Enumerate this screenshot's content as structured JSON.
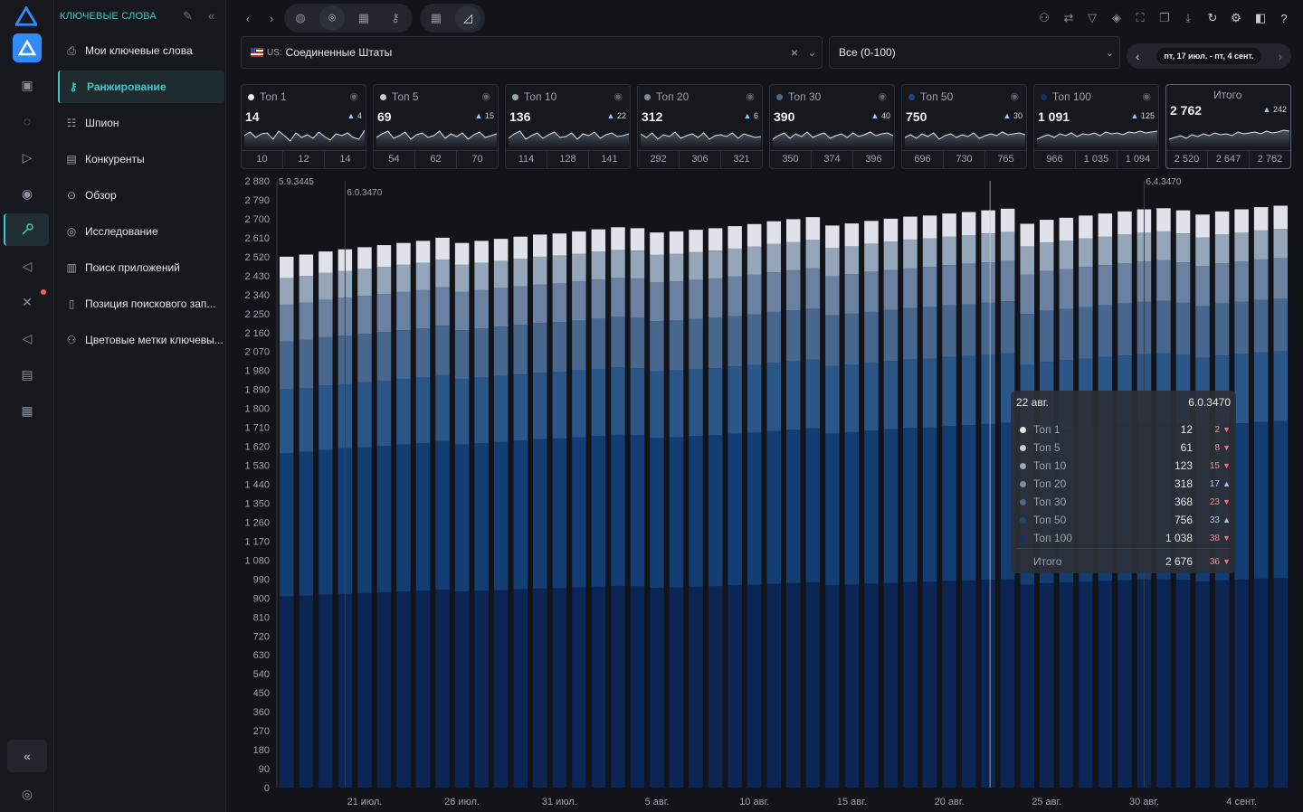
{
  "sidebar": {
    "title": "КЛЮЧЕВЫЕ СЛОВА",
    "items": [
      {
        "label": "Мои ключевые слова",
        "icon": "bookmark-icon"
      },
      {
        "label": "Ранжирование",
        "icon": "key-icon",
        "active": true
      },
      {
        "label": "Шпион",
        "icon": "stack-icon"
      },
      {
        "label": "Конкуренты",
        "icon": "book-icon"
      },
      {
        "label": "Обзор",
        "icon": "focus-icon"
      },
      {
        "label": "Исследование",
        "icon": "compass-icon"
      },
      {
        "label": "Поиск приложений",
        "icon": "bars-icon"
      },
      {
        "label": "Позиция поискового зап...",
        "icon": "document-icon"
      },
      {
        "label": "Цветовые метки ключевы...",
        "icon": "palette-icon"
      }
    ]
  },
  "filters": {
    "country_code": "US:",
    "country": "Соединенные Штаты",
    "range": "Все (0-100)",
    "date_range": "пт, 17 июл. - пт, 4 сент."
  },
  "cards": [
    {
      "label": "Топ 1",
      "value": "14",
      "change": "4",
      "color": "#e9ebef",
      "ticks": [
        "10",
        "12",
        "14"
      ]
    },
    {
      "label": "Топ 5",
      "value": "69",
      "change": "15",
      "color": "#c7cbd2",
      "ticks": [
        "54",
        "62",
        "70"
      ]
    },
    {
      "label": "Топ 10",
      "value": "136",
      "change": "22",
      "color": "#9aa6b8",
      "ticks": [
        "114",
        "128",
        "141"
      ]
    },
    {
      "label": "Топ 20",
      "value": "312",
      "change": "6",
      "color": "#7d8ba1",
      "ticks": [
        "292",
        "306",
        "321"
      ]
    },
    {
      "label": "Топ 30",
      "value": "390",
      "change": "40",
      "color": "#4f6888",
      "ticks": [
        "350",
        "374",
        "396"
      ]
    },
    {
      "label": "Топ 50",
      "value": "750",
      "change": "30",
      "color": "#1f4877",
      "ticks": [
        "696",
        "730",
        "765"
      ]
    },
    {
      "label": "Топ 100",
      "value": "1 091",
      "change": "125",
      "color": "#123363",
      "ticks": [
        "966",
        "1 035",
        "1 094"
      ]
    },
    {
      "label": "Итого",
      "value": "2 762",
      "change": "242",
      "color": "",
      "ticks": [
        "2 520",
        "2 647",
        "2 762"
      ]
    }
  ],
  "tooltip": {
    "date": "22 авг.",
    "version": "6.0.3470",
    "rows": [
      {
        "name": "Топ 1",
        "value": "12",
        "change": "2",
        "dir": "down",
        "color": "#e9ebef"
      },
      {
        "name": "Топ 5",
        "value": "61",
        "change": "8",
        "dir": "down",
        "color": "#c7cbd2"
      },
      {
        "name": "Топ 10",
        "value": "123",
        "change": "15",
        "dir": "down",
        "color": "#9aa6b8"
      },
      {
        "name": "Топ 20",
        "value": "318",
        "change": "17",
        "dir": "up",
        "color": "#7d8ba1"
      },
      {
        "name": "Топ 30",
        "value": "368",
        "change": "23",
        "dir": "down",
        "color": "#4f6888"
      },
      {
        "name": "Топ 50",
        "value": "756",
        "change": "33",
        "dir": "up",
        "color": "#1f4877"
      },
      {
        "name": "Топ 100",
        "value": "1 038",
        "change": "38",
        "dir": "down",
        "color": "#123363"
      }
    ],
    "total_label": "Итого",
    "total_value": "2 676",
    "total_change": "36",
    "total_dir": "down"
  },
  "chart_data": {
    "type": "bar",
    "stacked": true,
    "y_ticks": [
      "0",
      "90",
      "180",
      "270",
      "360",
      "450",
      "540",
      "630",
      "720",
      "810",
      "900",
      "990",
      "1 080",
      "1 170",
      "1 260",
      "1 350",
      "1 440",
      "1 530",
      "1 620",
      "1 710",
      "1 800",
      "1 890",
      "1 980",
      "2 070",
      "2 160",
      "2 250",
      "2 340",
      "2 430",
      "2 520",
      "2 610",
      "2 700",
      "2 790",
      "2 880"
    ],
    "ylim": [
      0,
      2880
    ],
    "x_labels": [
      "21 июл.",
      "26 июл.",
      "31 июл.",
      "5 авг.",
      "10 авг.",
      "15 авг.",
      "20 авг.",
      "25 авг.",
      "30 авг.",
      "4 сент."
    ],
    "x_label_index": [
      4,
      9,
      14,
      19,
      24,
      29,
      34,
      39,
      44,
      49
    ],
    "version_markers": [
      {
        "label": "5.9.3445",
        "index": 0
      },
      {
        "label": "6.0.3470",
        "index": 3
      },
      {
        "label": "6.4.3470",
        "index": 44
      }
    ],
    "highlight_index": 36,
    "series_colors": [
      "#0b2654",
      "#123e74",
      "#2a5688",
      "#47678f",
      "#6a81a1",
      "#95a6bb",
      "#dfe3e9"
    ],
    "totals": [
      2520,
      2530,
      2545,
      2555,
      2565,
      2575,
      2585,
      2595,
      2610,
      2585,
      2595,
      2605,
      2615,
      2625,
      2630,
      2640,
      2650,
      2660,
      2655,
      2635,
      2640,
      2648,
      2655,
      2665,
      2675,
      2688,
      2698,
      2708,
      2668,
      2678,
      2690,
      2700,
      2710,
      2715,
      2725,
      2732,
      2740,
      2748,
      2676,
      2695,
      2705,
      2715,
      2725,
      2735,
      2745,
      2750,
      2740,
      2720,
      2735,
      2745,
      2755,
      2762
    ]
  }
}
